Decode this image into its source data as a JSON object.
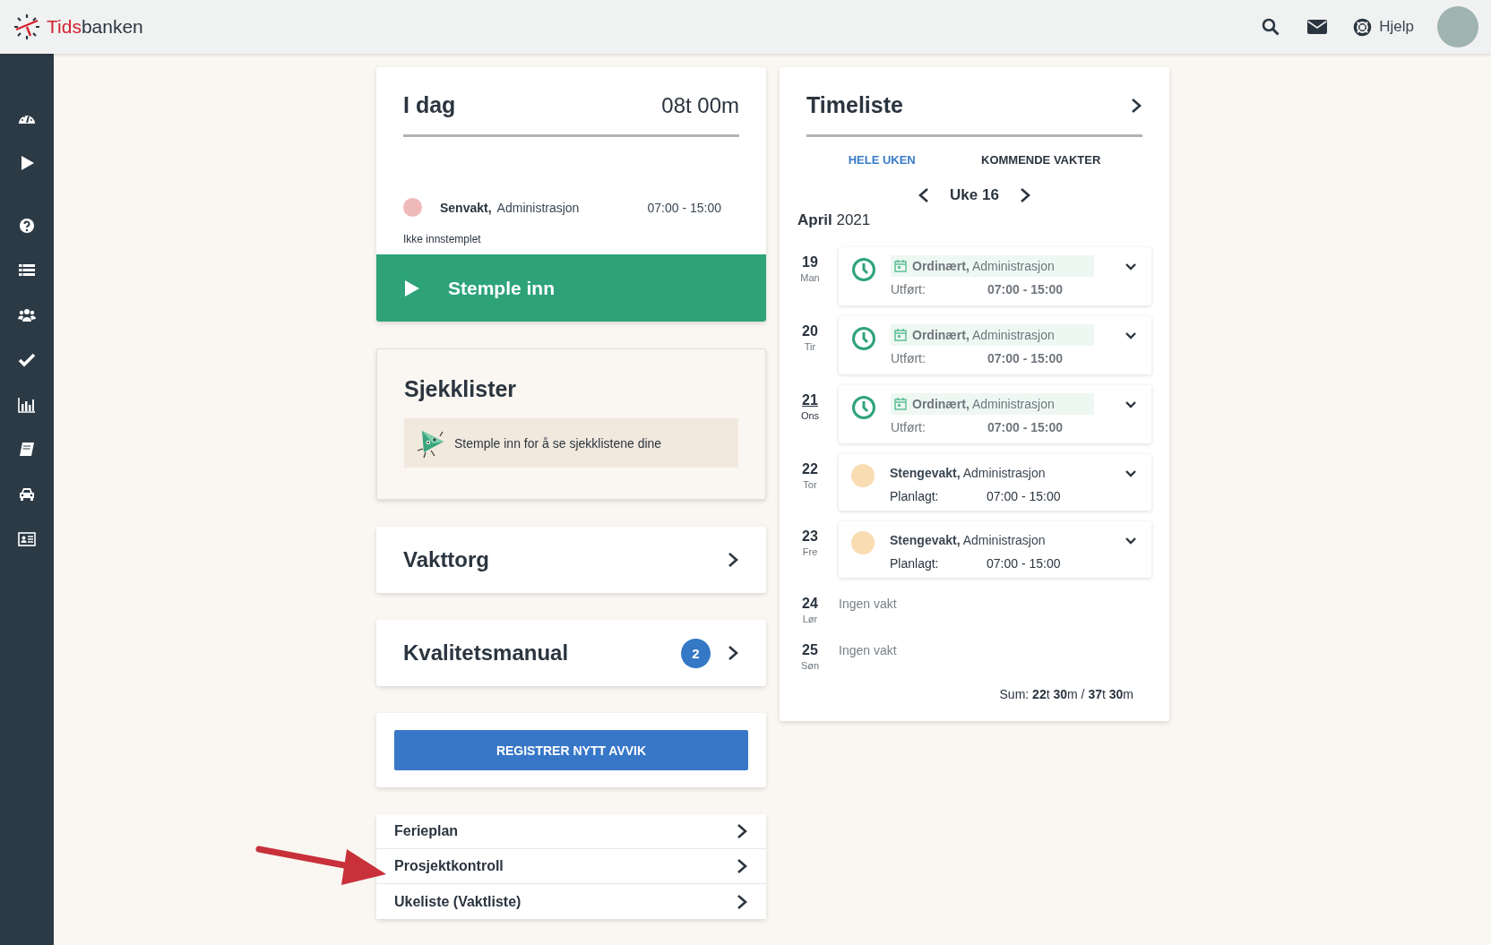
{
  "header": {
    "logo": {
      "accent": "Tids",
      "rest": "banken"
    },
    "help_link": "Hjelp"
  },
  "today": {
    "title": "I dag",
    "total": "08t 00m",
    "shift": {
      "name": "Senvakt,",
      "department": "Administrasjon",
      "time": "07:00 - 15:00",
      "color": "#f0b9b9"
    },
    "status": "Ikke innstemplet",
    "clock_in_button": "Stemple inn"
  },
  "checklists": {
    "title": "Sjekklister",
    "notice": "Stemple inn for å se sjekklistene dine"
  },
  "shift_market": {
    "title": "Vakttorg"
  },
  "quality_manual": {
    "title": "Kvalitetsmanual",
    "badge": "2"
  },
  "deviation_button": "REGISTRER NYTT AVVIK",
  "links": [
    {
      "label": "Ferieplan"
    },
    {
      "label": "Prosjektkontroll"
    },
    {
      "label": "Ukeliste (Vaktliste)"
    }
  ],
  "timesheet": {
    "title": "Timeliste",
    "tabs": [
      {
        "label": "HELE UKEN",
        "selected": true
      },
      {
        "label": "KOMMENDE VAKTER",
        "selected": false
      }
    ],
    "week": "Uke 16",
    "month": "April",
    "year": "2021",
    "days": [
      {
        "date": "19",
        "weekday": "Man",
        "today": false,
        "kind": "worked",
        "shift": "Ordinært,",
        "department": "Administrasjon",
        "label": "Utført:",
        "time": "07:00 - 15:00"
      },
      {
        "date": "20",
        "weekday": "Tir",
        "today": false,
        "kind": "worked",
        "shift": "Ordinært,",
        "department": "Administrasjon",
        "label": "Utført:",
        "time": "07:00 - 15:00"
      },
      {
        "date": "21",
        "weekday": "Ons",
        "today": true,
        "kind": "worked",
        "shift": "Ordinært,",
        "department": "Administrasjon",
        "label": "Utført:",
        "time": "07:00 - 15:00"
      },
      {
        "date": "22",
        "weekday": "Tor",
        "today": false,
        "kind": "planned",
        "color": "#f9dcb2",
        "shift": "Stengevakt,",
        "department": "Administrasjon",
        "label": "Planlagt:",
        "time": "07:00 - 15:00"
      },
      {
        "date": "23",
        "weekday": "Fre",
        "today": false,
        "kind": "planned",
        "color": "#f9dcb2",
        "shift": "Stengevakt,",
        "department": "Administrasjon",
        "label": "Planlagt:",
        "time": "07:00 - 15:00"
      },
      {
        "date": "24",
        "weekday": "Lør",
        "today": false,
        "kind": "empty",
        "note": "Ingen vakt"
      },
      {
        "date": "25",
        "weekday": "Søn",
        "today": false,
        "kind": "empty",
        "note": "Ingen vakt"
      }
    ],
    "sum": "Sum: **22**t **30**m / **37**t **30**m"
  }
}
